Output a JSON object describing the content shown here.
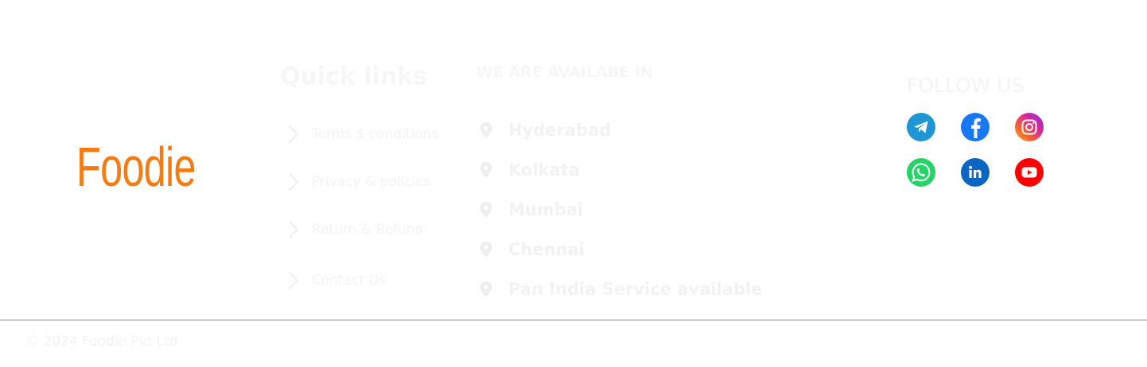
{
  "brand": {
    "name": "Foodie",
    "color": "#f47c10"
  },
  "quick_links": {
    "title": "Quick links",
    "items": [
      {
        "label": "Terms $ conditions"
      },
      {
        "label": "Privacy & policies"
      },
      {
        "label": "Return & Refund"
      },
      {
        "label": "Contact Us"
      }
    ]
  },
  "availability": {
    "title": "WE ARE AVAILABE IN",
    "locations": [
      {
        "label": "Hyderabad"
      },
      {
        "label": "Kolkata"
      },
      {
        "label": "Mumbai"
      },
      {
        "label": "Chennai"
      },
      {
        "label": "Pan India Service available"
      }
    ]
  },
  "follow": {
    "title": "FOLLOW US",
    "socials": [
      {
        "name": "telegram",
        "icon": "telegram-icon",
        "color": "#1e96d4"
      },
      {
        "name": "facebook",
        "icon": "facebook-icon",
        "color": "#1877f2"
      },
      {
        "name": "instagram",
        "icon": "instagram-icon",
        "color": "#d6249f"
      },
      {
        "name": "whatsapp",
        "icon": "whatsapp-icon",
        "color": "#25d366"
      },
      {
        "name": "linkedin",
        "icon": "linkedin-icon",
        "color": "#0a66c2"
      },
      {
        "name": "youtube",
        "icon": "youtube-icon",
        "color": "#ff0000"
      }
    ]
  },
  "footer": {
    "copyright": "© 2024 Foodie Pvt Ltd"
  }
}
